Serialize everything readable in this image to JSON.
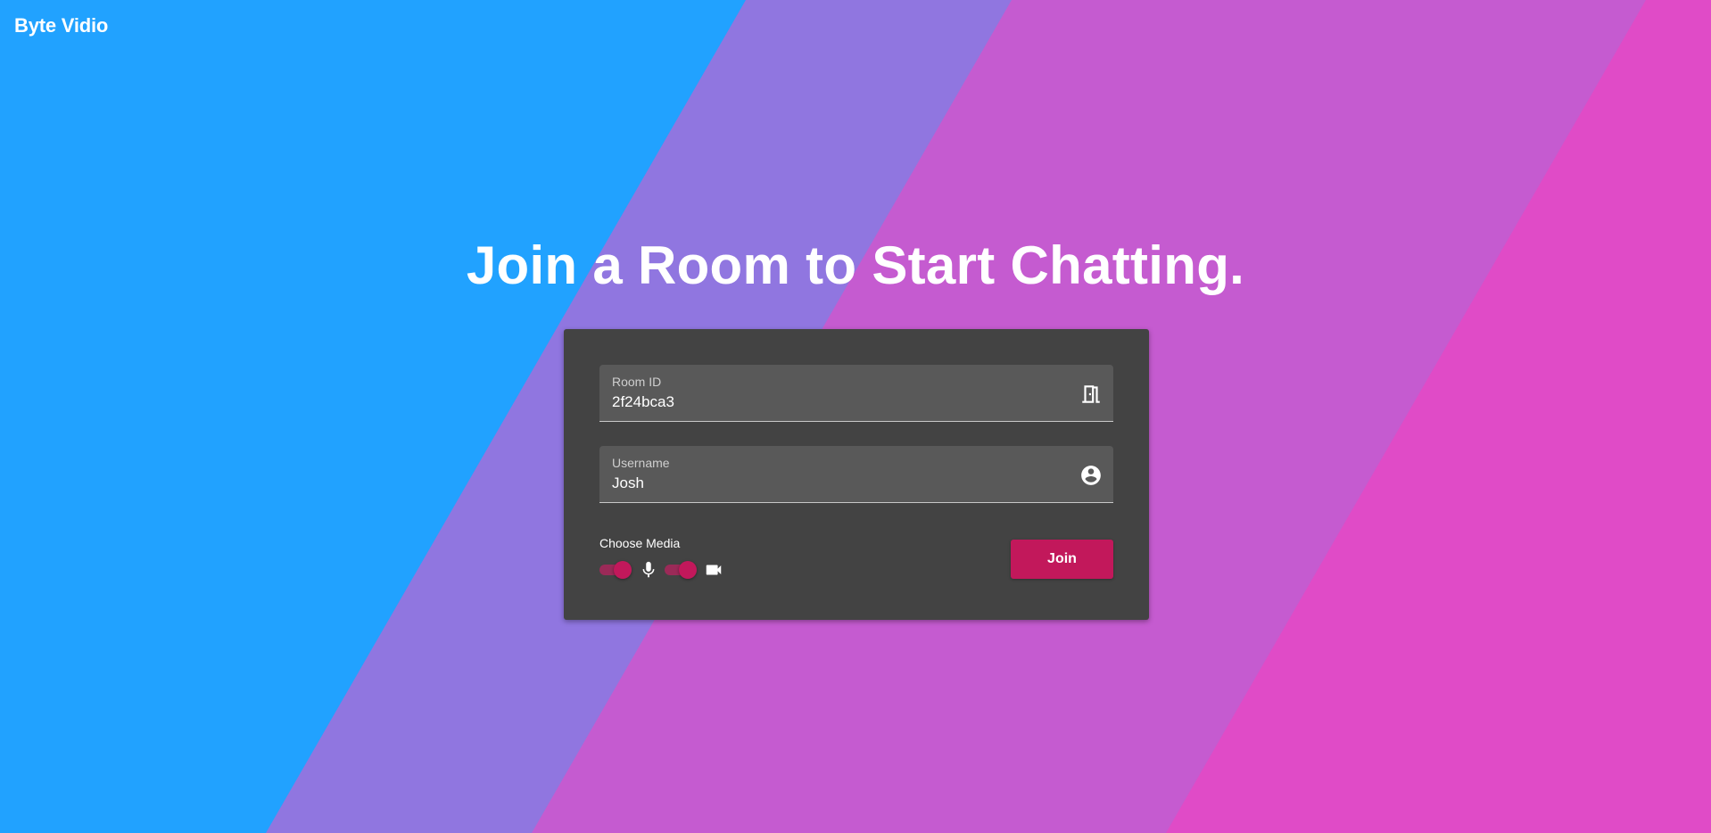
{
  "app": {
    "brand": "Byte Vidio"
  },
  "headline": "Join a Room to Start Chatting.",
  "form": {
    "room_id": {
      "label": "Room ID",
      "value": "2f24bca3",
      "icon": "door-icon"
    },
    "username": {
      "label": "Username",
      "value": "Josh",
      "icon": "account-circle-icon"
    },
    "media": {
      "label": "Choose Media",
      "microphone_enabled": true,
      "camera_enabled": true,
      "mic_icon": "microphone-icon",
      "camera_icon": "videocam-icon"
    },
    "join_label": "Join"
  },
  "colors": {
    "background_blue": "#21a2ff",
    "stripe_purple": "#9076e0",
    "stripe_magenta": "#c55bd0",
    "stripe_pink": "#e04bc7",
    "card": "#434343",
    "field": "#595959",
    "accent": "#c2185b"
  }
}
